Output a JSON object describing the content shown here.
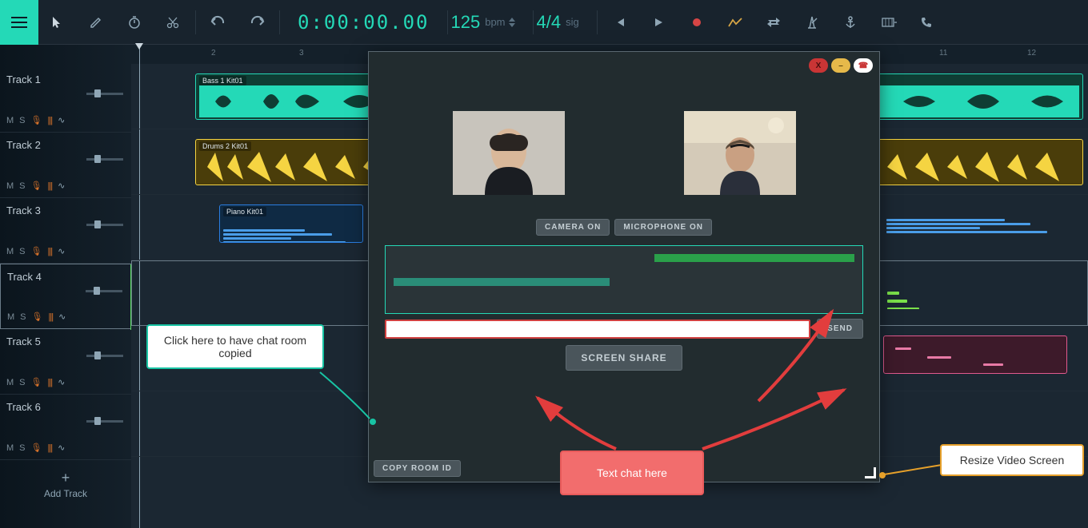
{
  "toolbar": {
    "time": "0:00:00.00",
    "bpm_value": "125",
    "bpm_label": "bpm",
    "sig_value": "4/4",
    "sig_label": "sig"
  },
  "ruler": {
    "marks": [
      "2",
      "3",
      "11",
      "12"
    ]
  },
  "tracks": [
    {
      "name": "Track 1",
      "color": "#24d9b7",
      "clip": {
        "label": "Bass 1 Kit01",
        "kind": "teal"
      }
    },
    {
      "name": "Track 2",
      "color": "#f5d442",
      "clip": {
        "label": "Drums 2 Kit01",
        "kind": "yellow"
      }
    },
    {
      "name": "Track 3",
      "color": "#2a7de0",
      "clip": {
        "label": "Piano Kit01",
        "kind": "blue"
      }
    },
    {
      "name": "Track 4",
      "color": "#5ae062",
      "clip": {
        "label": "",
        "kind": "green"
      }
    },
    {
      "name": "Track 5",
      "color": "#e05a8e",
      "clip": {
        "label": "",
        "kind": "pink"
      }
    },
    {
      "name": "Track 6",
      "color": "#b35ae0",
      "clip": null
    }
  ],
  "add_track_label": "Add Track",
  "video": {
    "camera_btn": "CAMERA ON",
    "mic_btn": "MICROPHONE ON",
    "send_btn": "SEND",
    "share_btn": "SCREEN SHARE",
    "copy_btn": "COPY ROOM ID",
    "close_label": "X",
    "min_label": "–",
    "hangup_label": "☎"
  },
  "callouts": {
    "copy": "Click here to have chat room copied",
    "chat": "Text chat here",
    "resize": "Resize Video Screen"
  }
}
